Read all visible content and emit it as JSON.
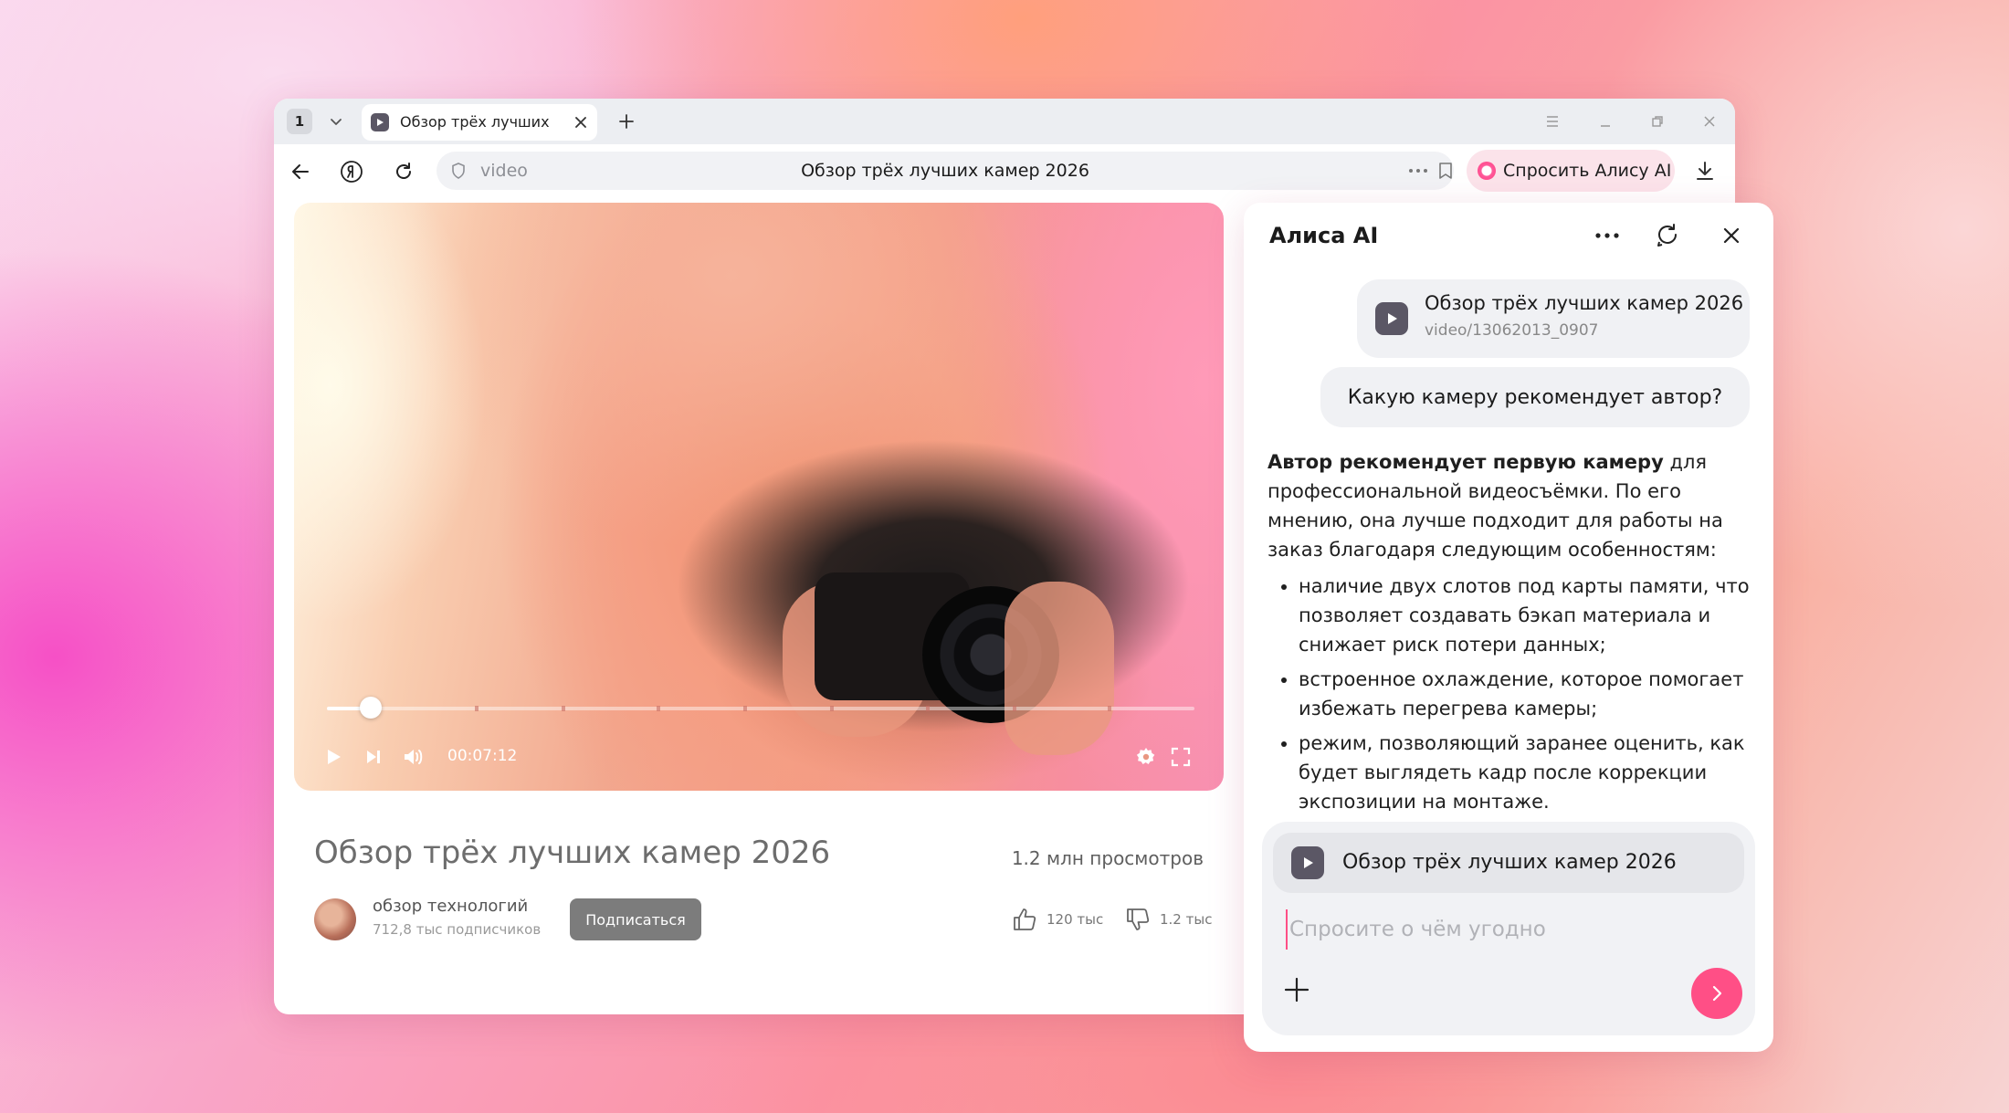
{
  "browser": {
    "tab_count": "1",
    "tab_title": "Обзор трёх лучших",
    "address_host": "video",
    "address_title": "Обзор трёх лучших камер 2026",
    "ask_alice_label": "Спросить Алису AI"
  },
  "video": {
    "time": "00:07:12",
    "progress": 0.05,
    "chapter_marks": [
      0.17,
      0.27,
      0.38,
      0.48,
      0.58,
      0.69,
      0.79,
      0.9
    ],
    "title": "Обзор трёх лучших камер 2026",
    "views": "1.2 млн просмотров",
    "channel_name": "обзор технологий",
    "channel_subscribers": "712,8 тыс подписчиков",
    "subscribe_label": "Подписаться",
    "likes": "120 тыс",
    "dislikes": "1.2 тыс"
  },
  "alice": {
    "title": "Алиса AI",
    "context_card": {
      "title": "Обзор трёх лучших камер 2026",
      "url": "video/13062013_0907"
    },
    "user_message": "Какую камеру рекомендует автор?",
    "answer_bold": "Автор рекомендует первую камеру",
    "answer_rest": " для профессиональной видеосъёмки. По его мнению, она лучше подходит для работы на заказ благодаря следующим особенностям:",
    "bullets": [
      "наличие двух слотов под карты памяти, что позволяет создавать бэкап материала и снижает риск потери данных;",
      "встроенное охлаждение, которое помогает избежать перегрева камеры;",
      "режим, позволяющий заранее оценить, как будет выглядеть кадр после коррекции экспозиции на монтаже."
    ],
    "composer_chip": "Обзор трёх лучших камер 2026",
    "composer_placeholder": "Спросите о чём угодно"
  },
  "colors": {
    "accent": "#ff4f86",
    "favicon": "#5b5765",
    "subscribe": "#7c7c7c"
  },
  "icons": [
    "chevron-down-icon",
    "play-icon",
    "close-icon",
    "plus-icon",
    "menu-icon",
    "minimize-icon",
    "restore-icon",
    "back-arrow-icon",
    "yandex-icon",
    "reload-icon",
    "shield-icon",
    "more-icon",
    "bookmark-icon",
    "alice-icon",
    "download-icon",
    "next-icon",
    "volume-icon",
    "settings-icon",
    "fullscreen-icon",
    "thumbs-up-icon",
    "thumbs-down-icon",
    "chat-refresh-icon",
    "send-icon"
  ]
}
